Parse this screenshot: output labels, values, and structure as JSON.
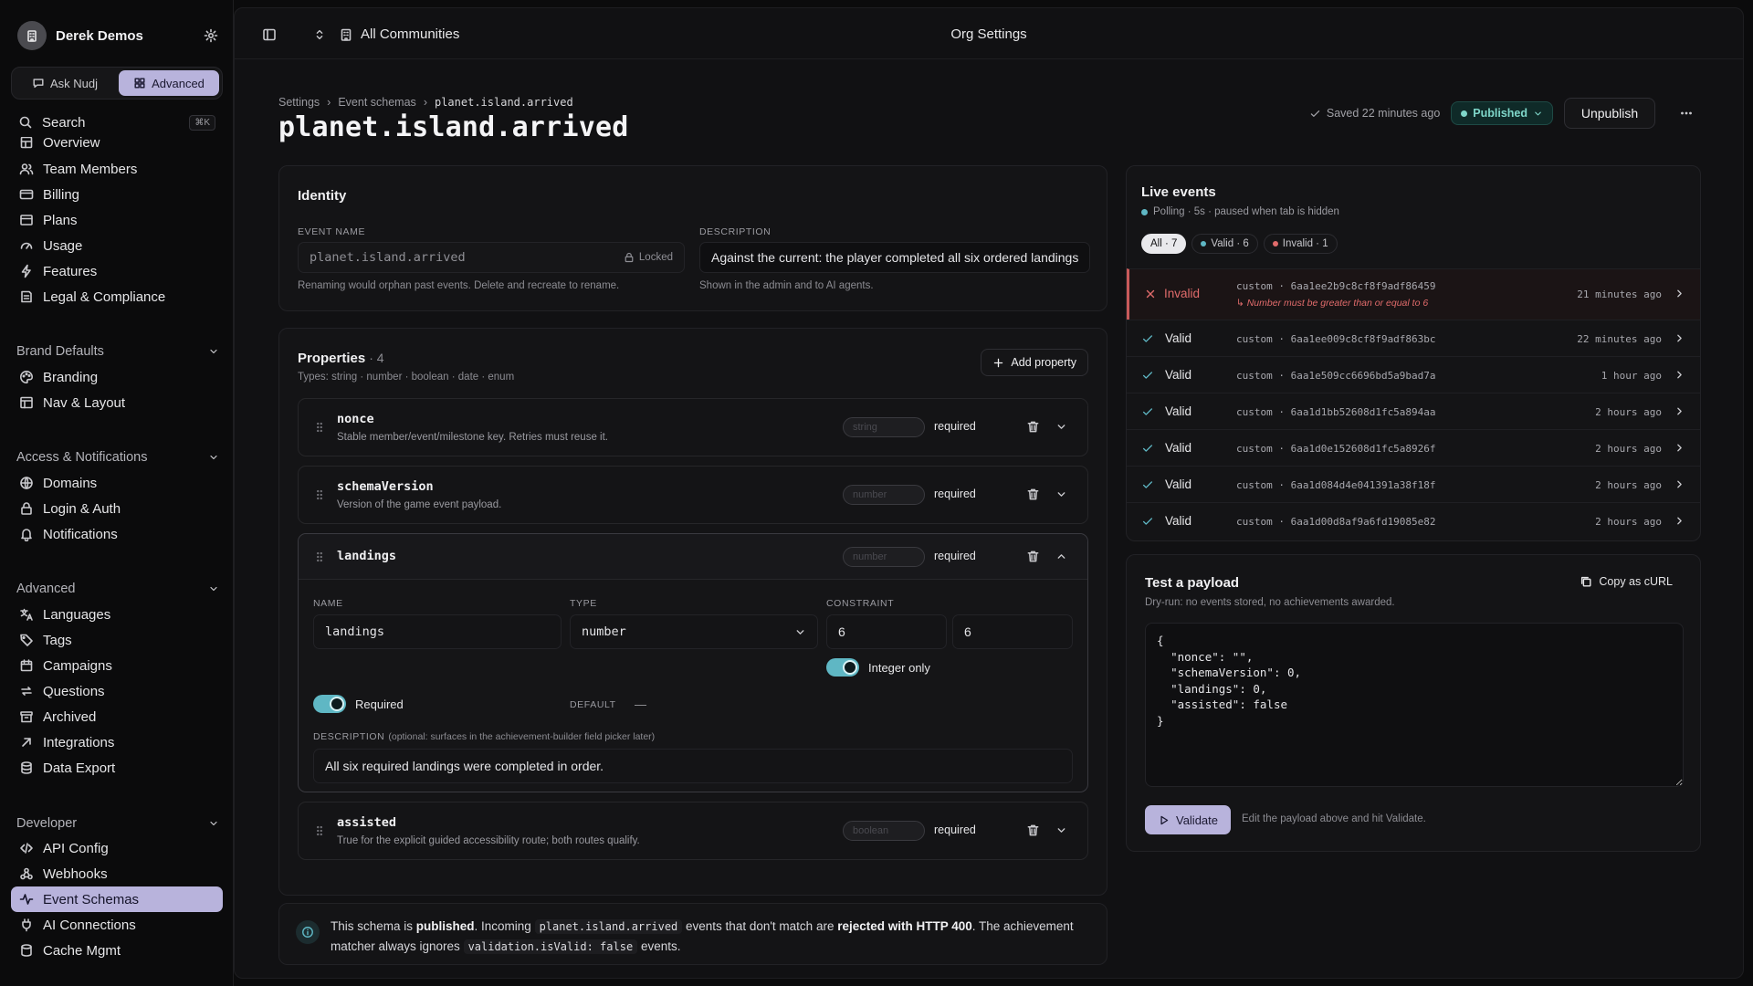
{
  "sidebar": {
    "org_name": "Derek Demos",
    "modes": [
      {
        "label": "Ask Nudj"
      },
      {
        "label": "Advanced"
      }
    ],
    "search_label": "Search",
    "search_shortcut": "⌘K",
    "top_items": [
      {
        "label": "Overview",
        "icon": "grid-icon"
      },
      {
        "label": "Team Members",
        "icon": "users-icon"
      },
      {
        "label": "Billing",
        "icon": "credit-card-icon"
      },
      {
        "label": "Plans",
        "icon": "layers-icon"
      },
      {
        "label": "Usage",
        "icon": "gauge-icon"
      },
      {
        "label": "Features",
        "icon": "zap-icon"
      },
      {
        "label": "Legal & Compliance",
        "icon": "scale-icon"
      }
    ],
    "sections": [
      {
        "title": "Brand Defaults",
        "items": [
          {
            "label": "Branding",
            "icon": "palette-icon"
          },
          {
            "label": "Nav & Layout",
            "icon": "layout-icon"
          }
        ]
      },
      {
        "title": "Access & Notifications",
        "items": [
          {
            "label": "Domains",
            "icon": "globe-icon"
          },
          {
            "label": "Login & Auth",
            "icon": "lock-icon"
          },
          {
            "label": "Notifications",
            "icon": "bell-icon"
          }
        ]
      },
      {
        "title": "Advanced",
        "items": [
          {
            "label": "Languages",
            "icon": "languages-icon"
          },
          {
            "label": "Tags",
            "icon": "tag-icon"
          },
          {
            "label": "Campaigns",
            "icon": "calendar-icon"
          },
          {
            "label": "Questions",
            "icon": "repeat-icon"
          },
          {
            "label": "Archived",
            "icon": "archive-icon"
          },
          {
            "label": "Integrations",
            "icon": "arrow-up-right-icon"
          },
          {
            "label": "Data Export",
            "icon": "database-icon"
          }
        ]
      },
      {
        "title": "Developer",
        "items": [
          {
            "label": "API Config",
            "icon": "code-icon"
          },
          {
            "label": "Webhooks",
            "icon": "webhook-icon"
          },
          {
            "label": "Event Schemas",
            "icon": "activity-icon",
            "active": true
          },
          {
            "label": "AI Connections",
            "icon": "plug-icon"
          },
          {
            "label": "Cache Mgmt",
            "icon": "server-icon"
          }
        ]
      }
    ]
  },
  "topbar": {
    "crumb": "All Communities",
    "center_title": "Org Settings"
  },
  "header": {
    "breadcrumb": [
      "Settings",
      "Event schemas",
      "planet.island.arrived"
    ],
    "title": "planet.island.arrived",
    "saved_text": "Saved 22 minutes ago",
    "status_badge": "Published",
    "unpublish_label": "Unpublish"
  },
  "identity": {
    "title": "Identity",
    "event_name_label": "EVENT NAME",
    "event_name_value": "planet.island.arrived",
    "locked_label": "Locked",
    "event_name_hint": "Renaming would orphan past events. Delete and recreate to rename.",
    "description_label": "DESCRIPTION",
    "description_value": "Against the current: the player completed all six ordered landings",
    "description_hint": "Shown in the admin and to AI agents."
  },
  "properties": {
    "title": "Properties",
    "count": "· 4",
    "types_hint": "Types: string · number · boolean · date · enum",
    "add_label": "Add property",
    "items": [
      {
        "name": "nonce",
        "desc": "Stable member/event/milestone key. Retries must reuse it.",
        "type": "string",
        "required": "required"
      },
      {
        "name": "schemaVersion",
        "desc": "Version of the game event payload.",
        "type": "number",
        "required": "required"
      },
      {
        "name": "landings",
        "desc": "",
        "type": "number",
        "required": "required"
      },
      {
        "name": "assisted",
        "desc": "True for the explicit guided accessibility route; both routes qualify.",
        "type": "boolean",
        "required": "required"
      }
    ],
    "expanded": {
      "name_label": "NAME",
      "name_value": "landings",
      "type_label": "TYPE",
      "type_value": "number",
      "constraint_label": "CONSTRAINT",
      "constraint_min": "6",
      "constraint_max": "6",
      "integer_only_label": "Integer only",
      "required_label": "Required",
      "default_label": "DEFAULT",
      "default_value": "—",
      "description_label": "DESCRIPTION",
      "description_hint": "(optional: surfaces in the achievement-builder field picker later)",
      "description_value": "All six required landings were completed in order."
    }
  },
  "notice": {
    "t1": "This schema is ",
    "b1": "published",
    "t2": ". Incoming ",
    "c1": "planet.island.arrived",
    "t3": " events that don't match are ",
    "b2": "rejected with HTTP 400",
    "t4": ". The achievement matcher always ignores ",
    "c2": "validation.isValid: false",
    "t5": " events."
  },
  "live_events": {
    "title": "Live events",
    "polling": "Polling · 5s · paused when tab is hidden",
    "filters": [
      {
        "label": "All · 7"
      },
      {
        "label": "Valid · 6",
        "color": "#5fb7c4"
      },
      {
        "label": "Invalid · 1",
        "color": "#e06b6b"
      }
    ],
    "rows": [
      {
        "status": "Invalid",
        "hash": "custom · 6aa1ee2b9c8cf8f9adf86459",
        "error": "↳ Number must be greater than or equal to 6",
        "time": "21 minutes ago"
      },
      {
        "status": "Valid",
        "hash": "custom · 6aa1ee009c8cf8f9adf863bc",
        "time": "22 minutes ago"
      },
      {
        "status": "Valid",
        "hash": "custom · 6aa1e509cc6696bd5a9bad7a",
        "time": "1 hour ago"
      },
      {
        "status": "Valid",
        "hash": "custom · 6aa1d1bb52608d1fc5a894aa",
        "time": "2 hours ago"
      },
      {
        "status": "Valid",
        "hash": "custom · 6aa1d0e152608d1fc5a8926f",
        "time": "2 hours ago"
      },
      {
        "status": "Valid",
        "hash": "custom · 6aa1d084d4e041391a38f18f",
        "time": "2 hours ago"
      },
      {
        "status": "Valid",
        "hash": "custom · 6aa1d00d8af9a6fd19085e82",
        "time": "2 hours ago"
      }
    ]
  },
  "test_payload": {
    "title": "Test a payload",
    "subtitle": "Dry-run: no events stored, no achievements awarded.",
    "copy_label": "Copy as cURL",
    "payload": "{\n  \"nonce\": \"\",\n  \"schemaVersion\": 0,\n  \"landings\": 0,\n  \"assisted\": false\n}",
    "validate_label": "Validate",
    "validate_hint": "Edit the payload above and hit Validate."
  },
  "colors": {
    "accent": "#b8b3dc",
    "valid": "#5fb7c4",
    "invalid": "#e06b6b",
    "published": "#7fd6c9"
  }
}
